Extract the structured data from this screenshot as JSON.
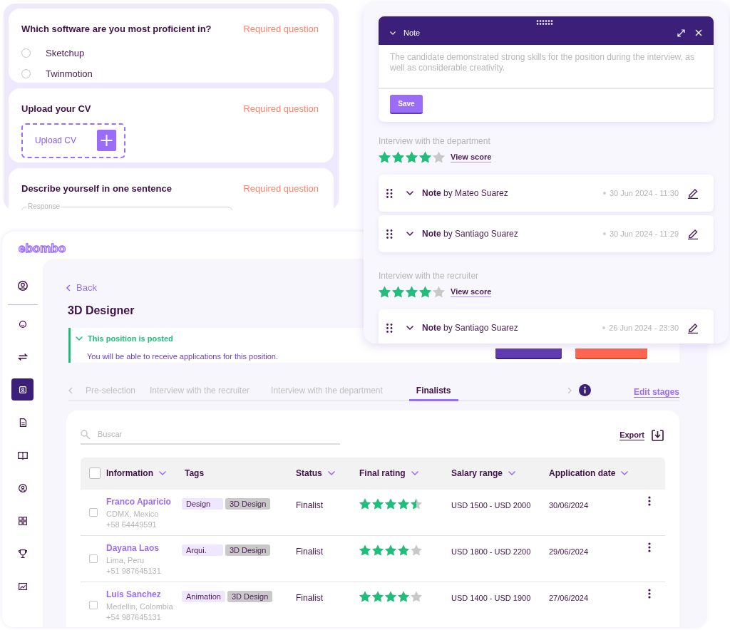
{
  "form_panel": {
    "questions": [
      {
        "kind": "radio",
        "title": "Which software are you most proficient in?",
        "required_label": "Required question",
        "options": [
          {
            "label": "Sketchup",
            "selected": false
          },
          {
            "label": "Twinmotion",
            "selected": false
          }
        ]
      },
      {
        "kind": "upload",
        "title": "Upload your CV",
        "required_label": "Required question",
        "upload_label": "Upload CV"
      },
      {
        "kind": "text",
        "title": "Describe yourself in one sentence",
        "required_label": "Required question",
        "field_label": "Response"
      }
    ]
  },
  "notes_panel": {
    "editor": {
      "title": "Note",
      "text": "The candidate demonstrated strong skills for the position during the interview, as well as considerable creativity.",
      "save_label": "Save"
    },
    "sections": [
      {
        "title": "Interview with the department",
        "stars": 4,
        "link": "View score",
        "notes": [
          {
            "label": "**Note** by Mateo Suarez",
            "date": "30 Jun 2024 - 11:30"
          },
          {
            "label": "**Note** by Santiago Suarez",
            "date": "30 Jun 2024 - 11:29"
          }
        ]
      },
      {
        "title": "Interview with the recruiter",
        "stars": 4,
        "link": "View score",
        "notes": [
          {
            "label": "**Note** by Santiago Suarez",
            "date": "26 Jun 2024 - 23:30"
          }
        ]
      }
    ]
  },
  "app": {
    "logo": "ebombo",
    "nav": [
      {
        "selected": false
      },
      {
        "selected": false
      },
      {
        "selected": false
      },
      {
        "selected": true
      },
      {
        "selected": false
      },
      {
        "selected": false
      },
      {
        "selected": false
      },
      {
        "selected": false
      },
      {
        "selected": false
      },
      {
        "selected": false
      }
    ],
    "back": "Back",
    "title": "3D Designer",
    "banner": {
      "title": "This position is posted",
      "text": "You will be able to receive applications for this position."
    },
    "tabs": [
      {
        "label": "Pre-selection",
        "selected": false
      },
      {
        "label": "Interview with the recruiter",
        "selected": false
      },
      {
        "label": "Interview with the department",
        "selected": false
      },
      {
        "label": "Finalists",
        "selected": true
      }
    ],
    "edit_stages": "Edit stages",
    "search_placeholder": "Buscar",
    "export": "Export",
    "table": {
      "all_selected": false,
      "columns": [
        {
          "label": "Information",
          "sortable": true
        },
        {
          "label": "Tags",
          "sortable": false
        },
        {
          "label": "Status",
          "sortable": true
        },
        {
          "label": "Final rating",
          "sortable": true
        },
        {
          "label": "Salary range",
          "sortable": true
        },
        {
          "label": "Application date",
          "sortable": true
        }
      ],
      "rows": [
        {
          "checked": false,
          "name": "Franco Aparicio",
          "location": "CDMX, Mexico",
          "phone": "+58 64449591",
          "tags": [
            {
              "label": "Design",
              "kind": "area"
            },
            {
              "label": "3D Design",
              "kind": "skill"
            }
          ],
          "status": "Finalist",
          "stars": 4.5,
          "salary": "USD 1500 - USD 2000",
          "date": "30/06/2024"
        },
        {
          "checked": false,
          "name": "Dayana Laos",
          "location": "Lima, Peru",
          "phone": "+51 987645131",
          "tags": [
            {
              "label": "Arqui.",
              "kind": "area"
            },
            {
              "label": "3D Design",
              "kind": "skill"
            }
          ],
          "status": "Finalist",
          "stars": 4,
          "salary": "USD 1800 - USD 2200",
          "date": "29/06/2024"
        },
        {
          "checked": false,
          "name": "Luis Sanchez",
          "location": "Medellin, Colombia",
          "phone": "+54 987645131",
          "tags": [
            {
              "label": "Animation",
              "kind": "area"
            },
            {
              "label": "3D Design",
              "kind": "skill"
            }
          ],
          "status": "Finalist",
          "stars": 4,
          "salary": "USD 1400 - USD 1900",
          "date": "27/06/2024"
        }
      ]
    }
  }
}
